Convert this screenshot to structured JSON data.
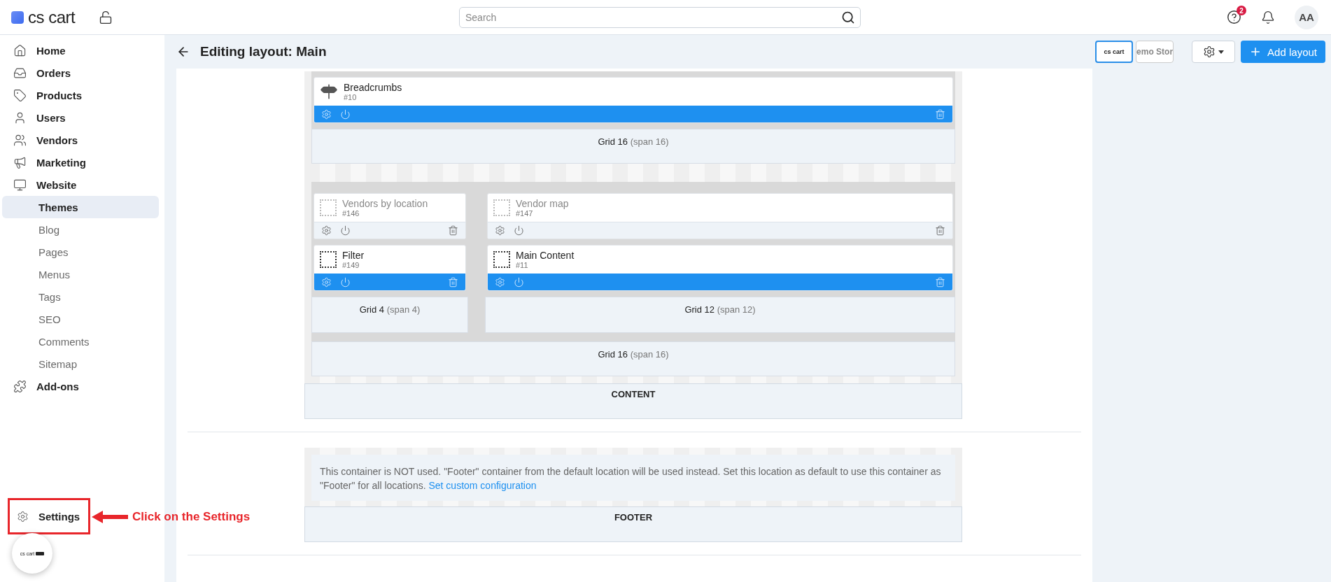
{
  "header": {
    "logo": "cs cart",
    "search": {
      "placeholder": "Search"
    },
    "help_badge": "2",
    "avatar": "AA"
  },
  "sidebar": {
    "items": [
      {
        "label": "Home",
        "selected": false
      },
      {
        "label": "Orders",
        "selected": false
      },
      {
        "label": "Products",
        "selected": false
      },
      {
        "label": "Users",
        "selected": false
      },
      {
        "label": "Vendors",
        "selected": false
      },
      {
        "label": "Marketing",
        "selected": false
      },
      {
        "label": "Website",
        "selected": false,
        "expanded": true,
        "children": [
          {
            "label": "Themes",
            "selected": true
          },
          {
            "label": "Blog",
            "selected": false
          },
          {
            "label": "Pages",
            "selected": false
          },
          {
            "label": "Menus",
            "selected": false
          },
          {
            "label": "Tags",
            "selected": false
          },
          {
            "label": "SEO",
            "selected": false
          },
          {
            "label": "Comments",
            "selected": false
          },
          {
            "label": "Sitemap",
            "selected": false
          }
        ]
      },
      {
        "label": "Add-ons",
        "selected": false
      }
    ],
    "settings": "Settings",
    "badge_logo": "cs cart"
  },
  "annotation": {
    "text": "Click on the Settings"
  },
  "page": {
    "title": "Editing layout: Main",
    "stores": [
      {
        "label": "cs cart",
        "selected": true
      },
      {
        "label": "emo Stor",
        "selected": false
      }
    ],
    "add_button": "Add layout"
  },
  "layout": {
    "rows": [
      {
        "label": "Grid 16",
        "span": "(span 16)",
        "columns": [
          {
            "blocks": [
              {
                "name": "Breadcrumbs",
                "id": "#10",
                "active": true,
                "kind": "signpost"
              }
            ]
          }
        ]
      },
      {
        "label": "Grid 16",
        "span": "(span 16)",
        "columns": [
          {
            "label": "Grid 4",
            "span": "(span 4)",
            "blocks": [
              {
                "name": "Vendors by location",
                "id": "#146",
                "active": false,
                "kind": "placeholder"
              },
              {
                "name": "Filter",
                "id": "#149",
                "active": true,
                "kind": "placeholder"
              }
            ]
          },
          {
            "label": "Grid 12",
            "span": "(span 12)",
            "blocks": [
              {
                "name": "Vendor map",
                "id": "#147",
                "active": false,
                "kind": "placeholder"
              },
              {
                "name": "Main Content",
                "id": "#11",
                "active": true,
                "kind": "placeholder"
              }
            ]
          }
        ]
      }
    ],
    "content_label": "CONTENT",
    "footer_notice": "This container is NOT used. \"Footer\" container from the default location will be used instead. Set this location as default to use this container as \"Footer\" for all locations.",
    "footer_link": "Set custom configuration",
    "footer_label": "FOOTER"
  }
}
